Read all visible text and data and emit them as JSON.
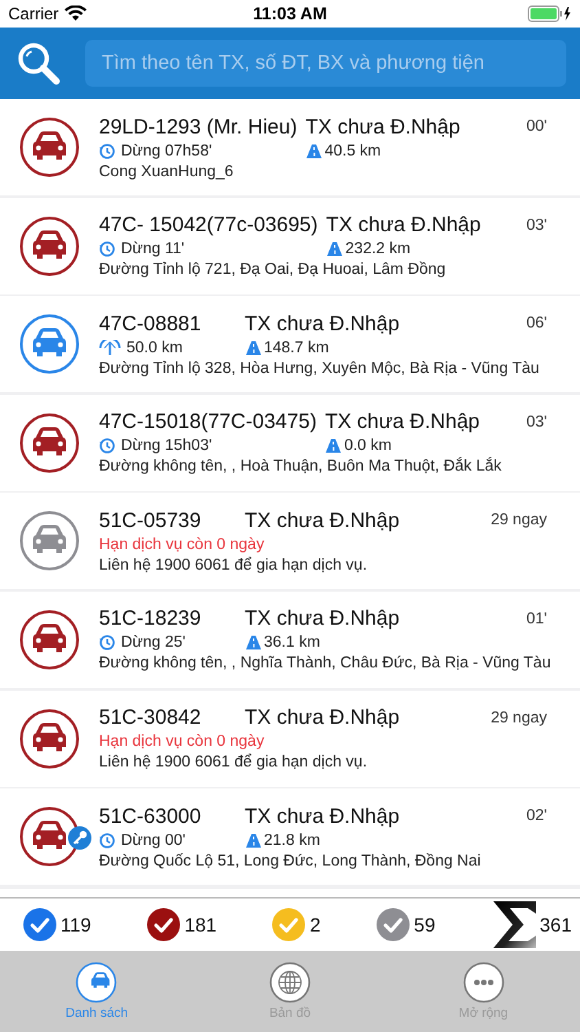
{
  "status_bar": {
    "carrier": "Carrier",
    "time": "11:03 AM"
  },
  "search": {
    "placeholder": "Tìm theo tên TX, số ĐT, BX và phương tiện"
  },
  "vehicles": [
    {
      "plate": "29LD-1293 (Mr. Hieu)",
      "status": "TX chưa Đ.Nhập",
      "time": "00'",
      "color": "#a31f24",
      "key": false,
      "kind": "stopped",
      "info": "Dừng 07h58'",
      "distance": "40.5 km",
      "address": "Cong XuanHung_6"
    },
    {
      "plate": "47C- 15042(77c-03695)",
      "status": "TX chưa Đ.Nhập",
      "time": "03'",
      "color": "#a31f24",
      "key": false,
      "kind": "stopped",
      "info": "Dừng 11'",
      "distance": "232.2 km",
      "address": "Đường Tỉnh lộ 721, Đạ Oai, Đạ Huoai, Lâm Đồng"
    },
    {
      "plate": "47C-08881",
      "status": "TX chưa Đ.Nhập",
      "time": "06'",
      "color": "#2a86e8",
      "key": false,
      "kind": "moving",
      "info": "50.0 km",
      "distance": "148.7 km",
      "address": "Đường Tỉnh lộ 328, Hòa Hưng, Xuyên Mộc, Bà Rịa - Vũng Tàu"
    },
    {
      "plate": "47C-15018(77C-03475)",
      "status": "TX chưa Đ.Nhập",
      "time": "03'",
      "color": "#a31f24",
      "key": false,
      "kind": "stopped",
      "info": "Dừng 15h03'",
      "distance": "0.0 km",
      "address": "Đường không tên, , Hoà Thuận, Buôn Ma Thuột, Đắk Lắk"
    },
    {
      "plate": "51C-05739",
      "status": "TX chưa Đ.Nhập",
      "time": "29 ngay",
      "color": "#8e8e93",
      "key": false,
      "kind": "expired",
      "info": "Hạn dịch vụ còn 0 ngày",
      "address": "Liên hệ 1900 6061 để gia hạn dịch vụ."
    },
    {
      "plate": "51C-18239",
      "status": "TX chưa Đ.Nhập",
      "time": "01'",
      "color": "#a31f24",
      "key": false,
      "kind": "stopped",
      "info": "Dừng 25'",
      "distance": "36.1 km",
      "address": "Đường không tên, , Nghĩa Thành, Châu Đức, Bà Rịa - Vũng Tàu"
    },
    {
      "plate": "51C-30842",
      "status": "TX chưa Đ.Nhập",
      "time": "29 ngay",
      "color": "#a31f24",
      "key": false,
      "kind": "expired",
      "info": "Hạn dịch vụ còn 0 ngày",
      "address": "Liên hệ 1900 6061 để gia hạn dịch vụ."
    },
    {
      "plate": "51C-63000",
      "status": "TX chưa Đ.Nhập",
      "time": "02'",
      "color": "#a31f24",
      "key": true,
      "kind": "stopped",
      "info": "Dừng 00'",
      "distance": "21.8 km",
      "address": "Đường Quốc Lộ 51, Long Đức, Long Thành, Đồng Nai"
    }
  ],
  "summary": [
    {
      "kind": "check",
      "count": "119",
      "color": "#1a73e8"
    },
    {
      "kind": "check",
      "count": "181",
      "color": "#9b1010"
    },
    {
      "kind": "check",
      "count": "2",
      "color": "#f5bd1f"
    },
    {
      "kind": "check",
      "count": "59",
      "color": "#8e8e93"
    },
    {
      "kind": "total",
      "count": "361"
    }
  ],
  "tabs": [
    {
      "kind": "car",
      "label": "Danh sách",
      "selected": true
    },
    {
      "kind": "globe",
      "label": "Bản đồ",
      "selected": false
    },
    {
      "kind": "more",
      "label": "Mở rộng",
      "selected": false
    }
  ]
}
